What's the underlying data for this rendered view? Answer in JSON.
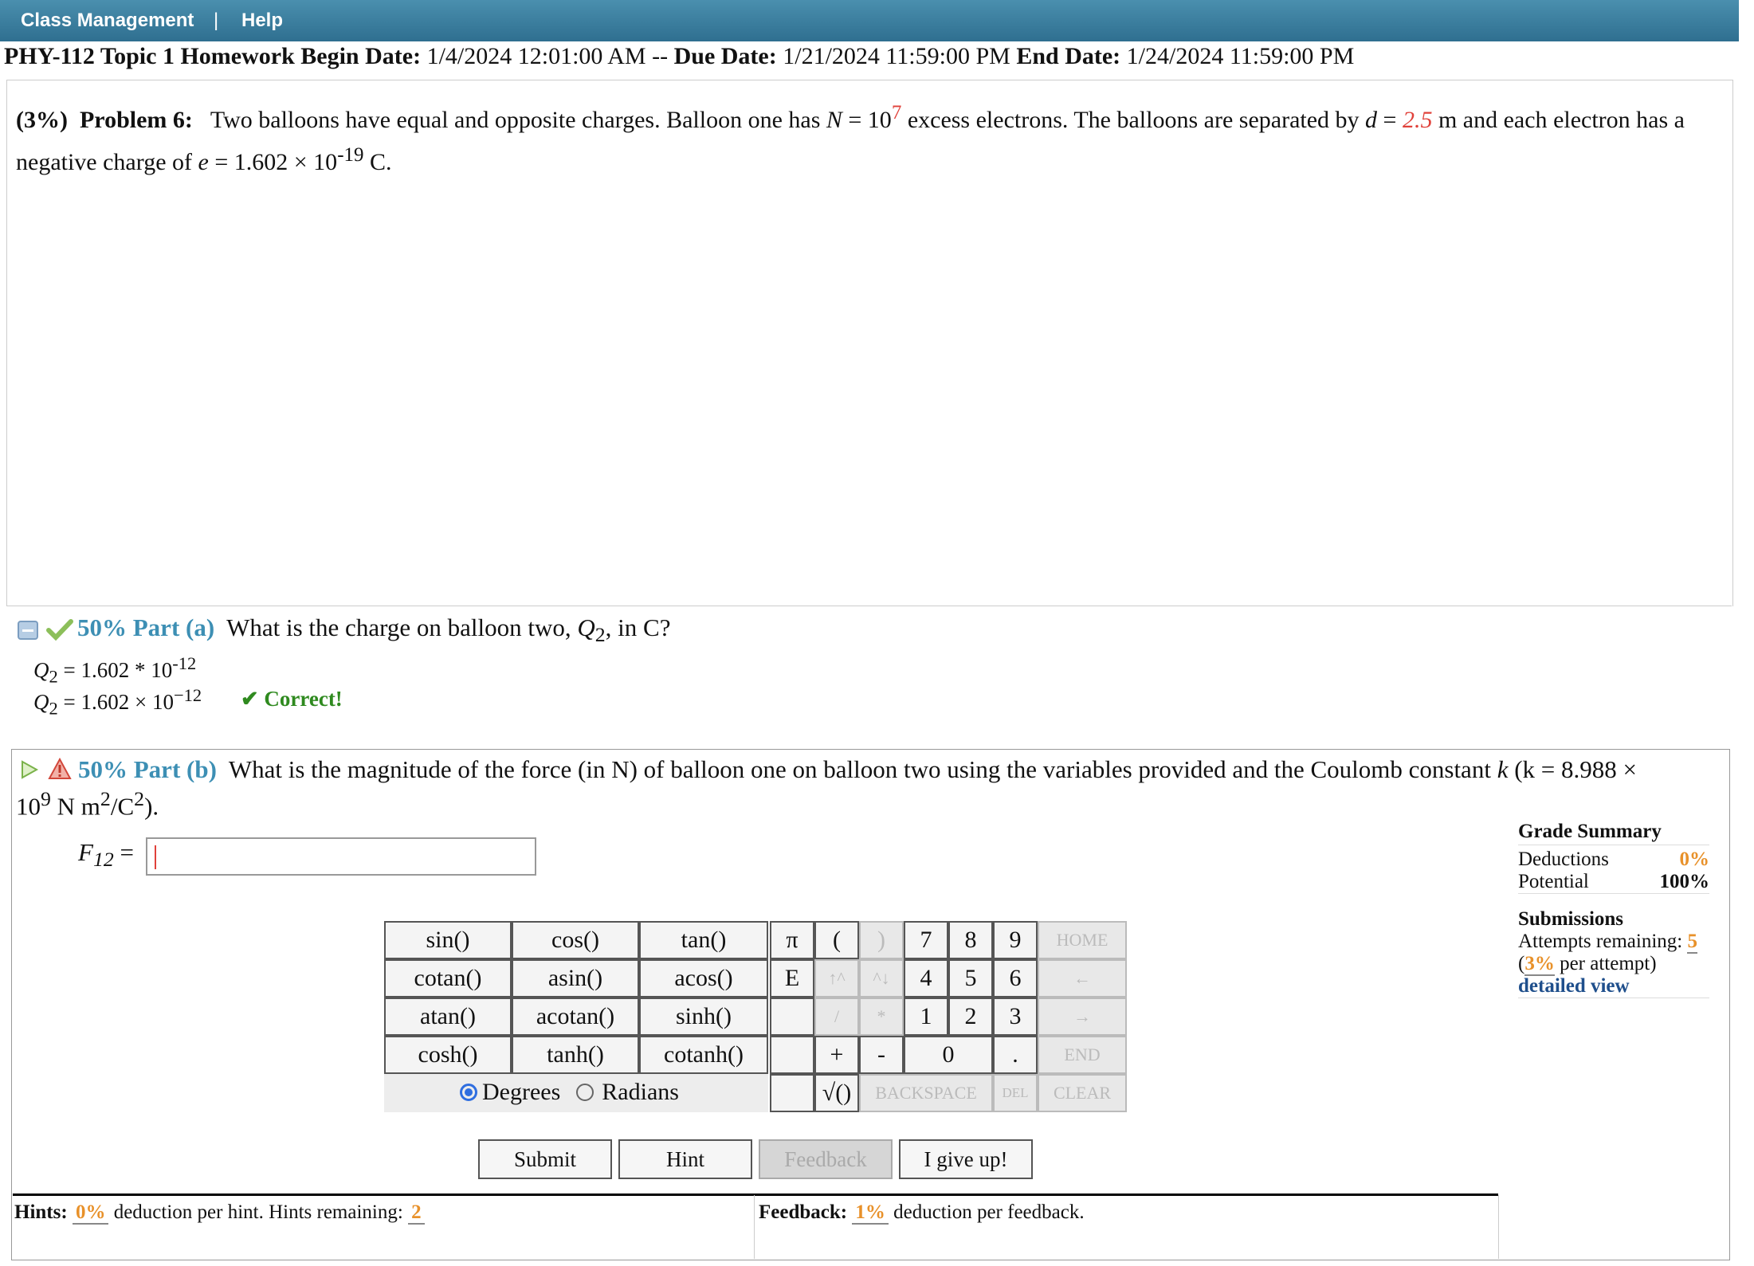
{
  "topbar": {
    "class_management": "Class Management",
    "separator": "|",
    "help": "Help"
  },
  "header": {
    "course": "PHY-112 Topic 1 Homework",
    "begin_label": "Begin Date:",
    "begin_value": "1/4/2024 12:01:00 AM --",
    "due_label": "Due Date:",
    "due_value": "1/21/2024 11:59:00 PM",
    "end_label": "End Date:",
    "end_value": "1/24/2024 11:59:00 PM"
  },
  "problem": {
    "weight": "(3%)",
    "title": "Problem 6:",
    "text1": "Two balloons have equal and opposite charges. Balloon one has",
    "n_var": "N",
    "n_base": "= 10",
    "n_exp": "7",
    "text2": "excess electrons. The balloons are separated by",
    "d_var": "d",
    "d_eq": "=",
    "d_value": "2.5",
    "text3": "m and each",
    "text4": "electron has a negative charge of",
    "e_var": "e",
    "e_value": "= 1.602 × 10",
    "e_exp": "-19",
    "e_unit": "C."
  },
  "part_a": {
    "percent": "50%",
    "label": "Part (a)",
    "question": "What is the charge on balloon two,",
    "q_var": "Q",
    "q_sub": "2",
    "question_end": ", in C?",
    "entered": "= 1.602 * 10",
    "entered_exp": "-12",
    "result": "= 1.602 × 10",
    "result_exp": "−12",
    "status": "✔ Correct!"
  },
  "part_b": {
    "percent": "50%",
    "label": "Part (b)",
    "question1": "What is the magnitude of the force (in N) of balloon one on balloon two using the variables provided and the Coulomb constant",
    "k_var": "k",
    "k_paren": "(k = 8.988 ×",
    "line2_base": "10",
    "line2_exp": "9",
    "line2_unit": "N m",
    "line2_exp2": "2",
    "line2_unit2": "/C",
    "line2_exp3": "2",
    "line2_end": ").",
    "answer_var": "F",
    "answer_sub": "12",
    "answer_eq": "=",
    "answer_value": ""
  },
  "keypad": {
    "functions": [
      [
        "sin()",
        "cos()",
        "tan()"
      ],
      [
        "cotan()",
        "asin()",
        "acos()"
      ],
      [
        "atan()",
        "acotan()",
        "sinh()"
      ],
      [
        "cosh()",
        "tanh()",
        "cotanh()"
      ]
    ],
    "degrees": "Degrees",
    "radians": "Radians",
    "pi": "π",
    "open": "(",
    "close": ")",
    "E": "E",
    "up": "↑^",
    "down": "^↓",
    "slash": "/",
    "star": "*",
    "plus": "+",
    "minus": "-",
    "sqrt": "√()",
    "digits": [
      "7",
      "8",
      "9",
      "4",
      "5",
      "6",
      "1",
      "2",
      "3",
      "0",
      "."
    ],
    "home": "HOME",
    "left": "←",
    "right": "→",
    "end": "END",
    "backspace": "BACKSPACE",
    "del": "DEL",
    "clear": "CLEAR"
  },
  "actions": {
    "submit": "Submit",
    "hint": "Hint",
    "feedback": "Feedback",
    "give_up": "I give up!"
  },
  "footer": {
    "hints_label": "Hints:",
    "hints_pct": "0%",
    "hints_text": "deduction per hint. Hints remaining:",
    "hints_remaining": "2",
    "feedback_label": "Feedback:",
    "feedback_pct": "1%",
    "feedback_text": "deduction per feedback."
  },
  "sidebar": {
    "grade_title": "Grade Summary",
    "deductions_label": "Deductions",
    "deductions_value": "0%",
    "potential_label": "Potential",
    "potential_value": "100%",
    "submissions_title": "Submissions",
    "attempts_label": "Attempts remaining:",
    "attempts_value": "5",
    "per_attempt_pct": "3%",
    "per_attempt_text": "per attempt)",
    "detailed": "detailed view"
  },
  "colors": {
    "topbar": "#3a7fa0",
    "accent_blue": "#3d8fb4",
    "red": "#e0413a",
    "orange": "#e8912a",
    "correct_green": "#2f8a1f"
  }
}
